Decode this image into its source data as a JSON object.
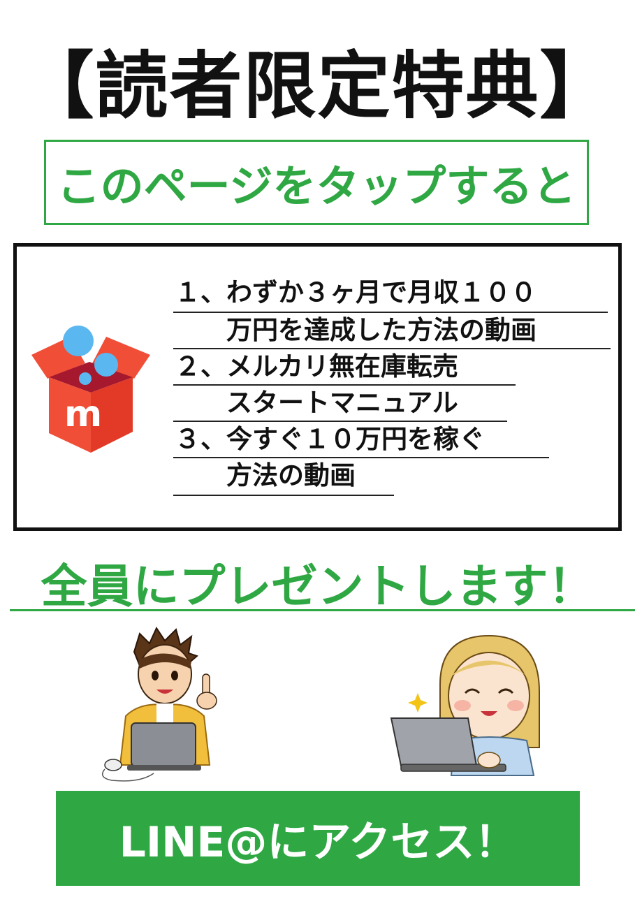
{
  "title": "【読者限定特典】",
  "subtitle": "このページをタップすると",
  "benefits": {
    "items": [
      {
        "line1": "１、わずか３ヶ月で月収１００",
        "line2": "　　万円を達成した方法の動画"
      },
      {
        "line1": "２、メルカリ無在庫転売",
        "line2": "　　スタートマニュアル"
      },
      {
        "line1": "３、今すぐ１０万円を稼ぐ",
        "line2": "　　方法の動画"
      }
    ],
    "logo_letter": "m"
  },
  "present": "全員にプレゼントします！",
  "button": {
    "label": "LINE@にアクセス！"
  },
  "colors": {
    "accent_green": "#2fa844",
    "text_dark": "#111111",
    "mercari_red": "#f04e37",
    "mercari_dark": "#a6182e",
    "bubble_blue": "#5bb7f0"
  }
}
